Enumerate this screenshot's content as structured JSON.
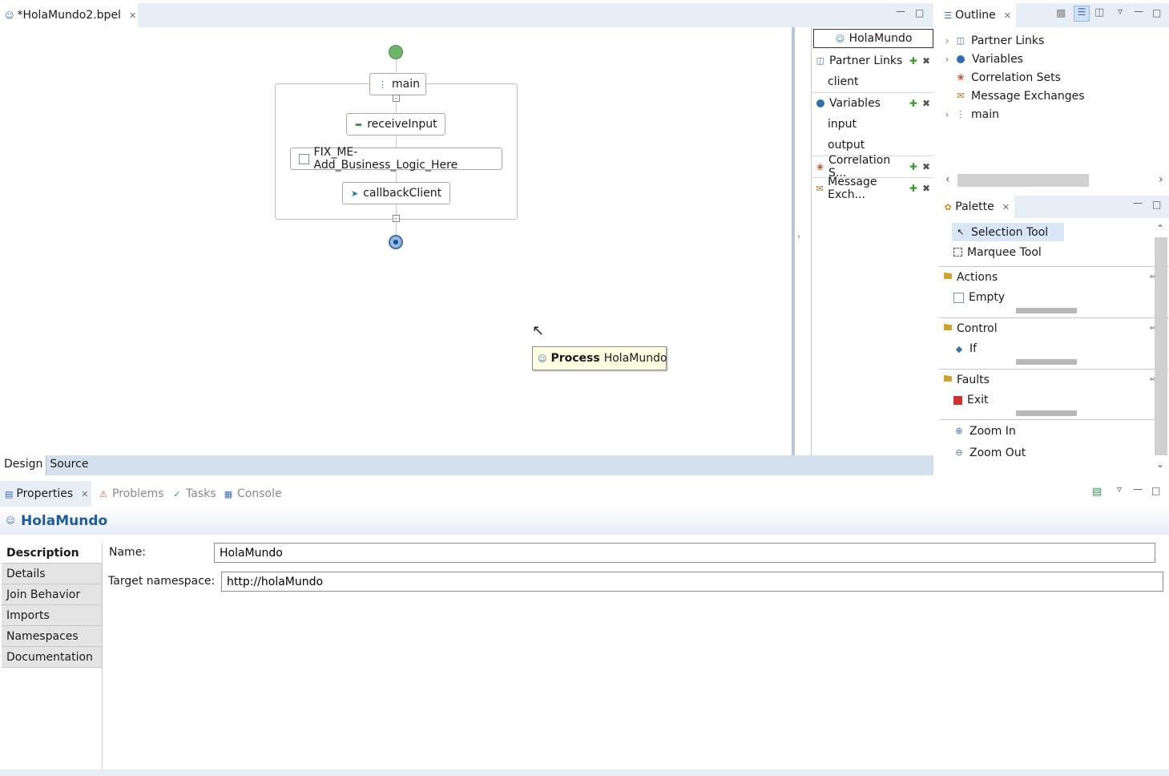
{
  "editor": {
    "tab_title": "*HolaMundo2.bpel",
    "bottom_tabs": [
      "Design",
      "Source"
    ]
  },
  "diagram": {
    "sequence_label": "main",
    "activities": [
      "receiveInput",
      "FIX_ME-Add_Business_Logic_Here",
      "callbackClient"
    ],
    "tooltip_prefix": "Process",
    "tooltip_name": "HolaMundo"
  },
  "tray": {
    "process_name": "HolaMundo",
    "partner_links_label": "Partner Links",
    "partner_links": [
      "client"
    ],
    "variables_label": "Variables",
    "variables": [
      "input",
      "output"
    ],
    "correlation_label": "Correlation S...",
    "message_exch_label": "Message Exch..."
  },
  "outline": {
    "title": "Outline",
    "items": [
      "Partner Links",
      "Variables",
      "Correlation Sets",
      "Message Exchanges",
      "main"
    ]
  },
  "palette": {
    "title": "Palette",
    "tools": [
      "Selection Tool",
      "Marquee Tool"
    ],
    "drawers": [
      {
        "label": "Actions",
        "item": "Empty"
      },
      {
        "label": "Control",
        "item": "If"
      },
      {
        "label": "Faults",
        "item": "Exit"
      }
    ],
    "zoom": [
      "Zoom In",
      "Zoom Out"
    ]
  },
  "bottom": {
    "tabs": [
      "Properties",
      "Problems",
      "Tasks",
      "Console"
    ],
    "heading": "HolaMundo",
    "side_tabs": [
      "Description",
      "Details",
      "Join Behavior",
      "Imports",
      "Namespaces",
      "Documentation"
    ],
    "name_label": "Name:",
    "name_value": "HolaMundo",
    "ns_label": "Target namespace:",
    "ns_value": "http://holaMundo"
  },
  "colors": {
    "accent": "#1f5c99",
    "tab_strip": "#e8eef6",
    "start_node": "#6db36d",
    "end_node": "#3a6fb0",
    "tooltip_bg": "#ffffe1"
  }
}
